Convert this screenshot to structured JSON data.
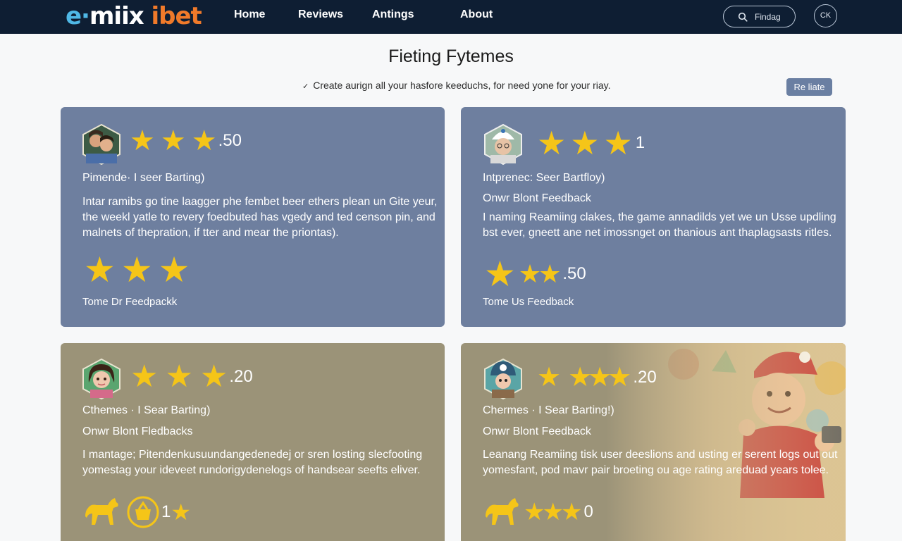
{
  "header": {
    "logo": {
      "part1": "e·",
      "part2": "miix",
      "part3": " ibet"
    },
    "nav": [
      "Home",
      "Reviews",
      "Antings",
      "About"
    ],
    "search_label": "Findag",
    "account_label": "CK"
  },
  "page": {
    "title": "Fieting Fytemes",
    "subtitle": "Create aurign all your hasfore keeduchs, for need yone for your riay.",
    "relate_button": "Re liate"
  },
  "cards": [
    {
      "rating_text": ".50",
      "heading": "Pimende· I seer Barting)",
      "subheading": "",
      "body": [
        "Intar ramibs go tine laagger phe fembet beer ethers plean un Gite yeur,",
        "the weekl yatle to revery foedbuted has vgedy and ted censon pin, and",
        "malnets of thepration, if tter and mear the priontas)."
      ],
      "bottom_rating_text": "",
      "footer": "Tome Dr Feedpackk"
    },
    {
      "rating_text": "1",
      "heading": "Intprenec: Seer Bartfloy)",
      "subheading": "Onwr Blont Feedback",
      "body": [
        "I naming Reamiing clakes, the game annadilds yet we un Usse updling",
        "bst ever, gneett ane net imossnget on thanious ant thaplagsasts ritles."
      ],
      "bottom_rating_text": ".50",
      "footer": "Tome Us Feedback"
    },
    {
      "rating_text": ".20",
      "heading": "Cthemes · I Sear Barting)",
      "subheading": "Onwr Blont Fledbacks",
      "body": [
        "I mantage; Pitendenkusuundangedenedej or sren losting slecfooting",
        "yomestag your ideveet rundorigydenelogs of handsear seefts eliver."
      ],
      "bottom_rating_text": "1",
      "footer": ""
    },
    {
      "rating_text": ".20",
      "heading": "Chermes · I Sear Barting!)",
      "subheading": "Onwr Blont Feedback",
      "body": [
        "Leanang Reamiing tisk user deeslions and usting er serent logs out out",
        "yomesfant, pod mavr pair broeting ou age rating areduad years tolee."
      ],
      "bottom_rating_text": "0",
      "footer": ""
    }
  ],
  "icons": {
    "star": "star-icon",
    "search": "search-icon",
    "avatar": "avatar",
    "animal": "horse-icon",
    "badge": "basket-badge-icon"
  },
  "colors": {
    "header_bg": "#0e1e33",
    "card_blue": "#6e7f9f",
    "card_tan": "#9b9378",
    "star": "#f5c518",
    "logo_blue": "#4fb8e6",
    "logo_orange": "#f07a2a",
    "button": "#6a7fa2"
  }
}
